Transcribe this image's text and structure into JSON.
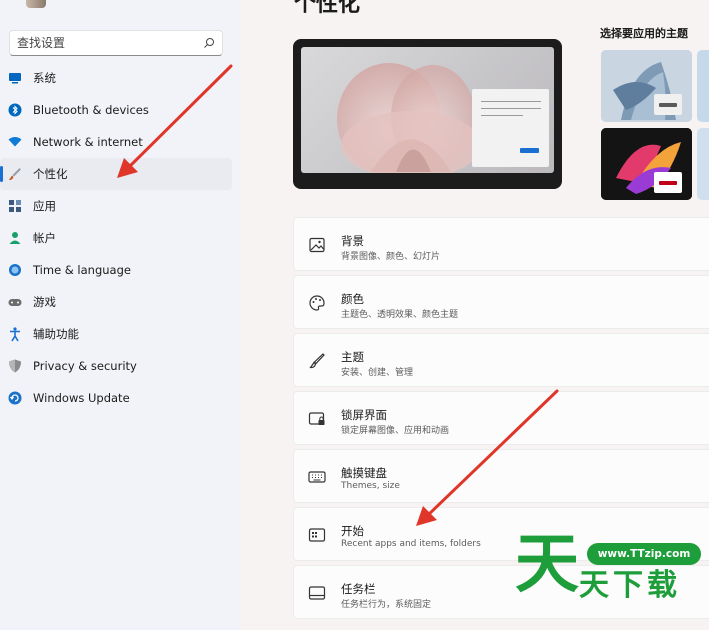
{
  "header": {
    "title_stub": "个性化"
  },
  "search": {
    "placeholder": "查找设置"
  },
  "sidebar": {
    "items": [
      {
        "label": "系统",
        "icon": "system-icon",
        "color": "#0067c0"
      },
      {
        "label": "Bluetooth & devices",
        "icon": "bluetooth-icon",
        "color": "#0067c0"
      },
      {
        "label": "Network & internet",
        "icon": "network-icon",
        "color": "#0f7ad8"
      },
      {
        "label": "个性化",
        "icon": "brush-icon",
        "color": "#c25a1f",
        "active": true
      },
      {
        "label": "应用",
        "icon": "apps-icon",
        "color": "#3c5a7d"
      },
      {
        "label": "帐户",
        "icon": "account-icon",
        "color": "#18a06b"
      },
      {
        "label": "Time & language",
        "icon": "time-language-icon",
        "color": "#1a73c8"
      },
      {
        "label": "游戏",
        "icon": "gaming-icon",
        "color": "#6c6c6c"
      },
      {
        "label": "辅助功能",
        "icon": "accessibility-icon",
        "color": "#1a6fd0"
      },
      {
        "label": "Privacy & security",
        "icon": "shield-icon",
        "color": "#7a7a7a"
      },
      {
        "label": "Windows Update",
        "icon": "update-icon",
        "color": "#1a73c8"
      }
    ]
  },
  "themes": {
    "title": "选择要应用的主题",
    "items": [
      {
        "name": "theme-light-bloom",
        "bg": "#c9d6e2",
        "badge_bg": "#f0f0f0",
        "badge_bar": "#5a5a5a"
      },
      {
        "name": "theme-partial-top",
        "bg": "#c6d9ea"
      },
      {
        "name": "theme-dark-glow",
        "bg": "#1a1a1a",
        "badge_bg": "#ffffff",
        "badge_bar": "#c00016"
      },
      {
        "name": "theme-partial-bottom",
        "bg": "#d0dfee"
      }
    ]
  },
  "settings": [
    {
      "title": "背景",
      "subtitle": "背景图像、颜色、幻灯片",
      "icon": "image-icon"
    },
    {
      "title": "颜色",
      "subtitle": "主题色、透明效果、颜色主题",
      "icon": "palette-icon"
    },
    {
      "title": "主题",
      "subtitle": "安装、创建、管理",
      "icon": "brush-icon"
    },
    {
      "title": "锁屏界面",
      "subtitle": "锁定屏幕图像、应用和动画",
      "icon": "lock-screen-icon"
    },
    {
      "title": "触摸键盘",
      "subtitle": "Themes, size",
      "icon": "keyboard-icon"
    },
    {
      "title": "开始",
      "subtitle": "Recent apps and items, folders",
      "icon": "start-icon"
    },
    {
      "title": "任务栏",
      "subtitle": "任务栏行为，系统固定",
      "icon": "taskbar-icon"
    }
  ],
  "accent": "#1a6fd0",
  "watermark": {
    "url": "www.TTzip.com",
    "big": "天",
    "rest": "天下载",
    "color": "#1e9e3b"
  },
  "arrow_color": "#e0362a"
}
